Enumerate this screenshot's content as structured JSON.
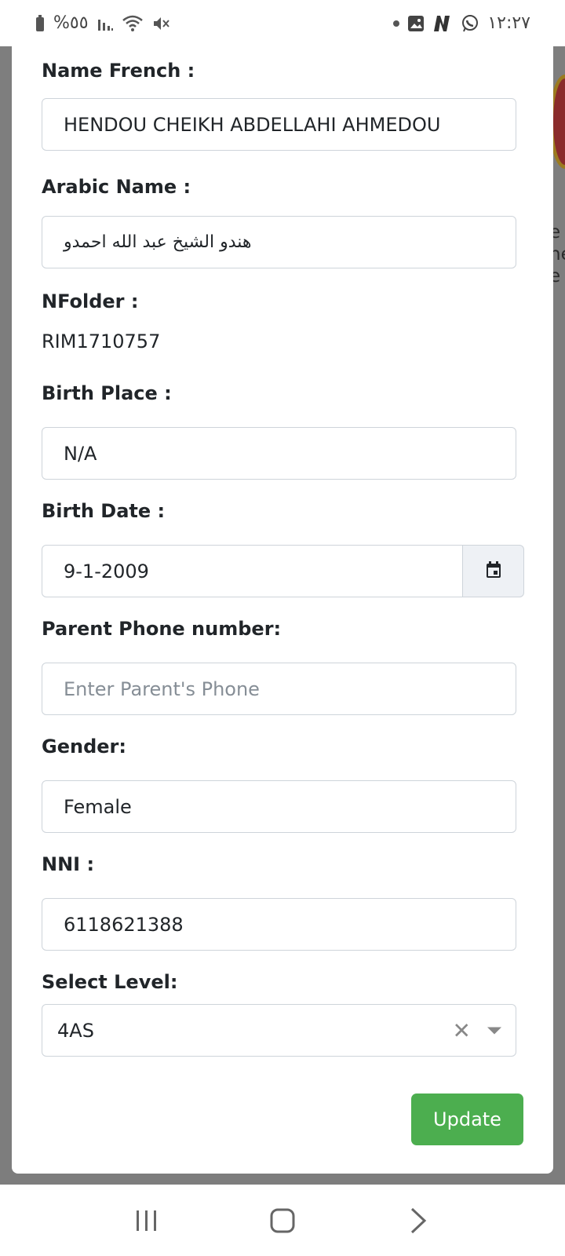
{
  "status_bar": {
    "battery_text": "%٥٥",
    "time": "١٢:٢٧"
  },
  "form": {
    "name_french": {
      "label": "Name French :",
      "value": "HENDOU CHEIKH ABDELLAHI AHMEDOU"
    },
    "arabic_name": {
      "label": "Arabic Name :",
      "value": "هندو الشيخ عبد الله احمدو"
    },
    "nfolder": {
      "label": "NFolder :",
      "value": "RIM1710757"
    },
    "birth_place": {
      "label": "Birth Place :",
      "value": "N/A"
    },
    "birth_date": {
      "label": "Birth Date :",
      "value": "9-1-2009"
    },
    "parent_phone": {
      "label": "Parent Phone number:",
      "placeholder": "Enter Parent's Phone"
    },
    "gender": {
      "label": "Gender:",
      "value": "Female"
    },
    "nni": {
      "label": "NNI :",
      "value": "6118621388"
    },
    "level": {
      "label": "Select Level:",
      "selected": "4AS"
    },
    "update_label": "Update"
  },
  "background": {
    "text_lines": [
      "e",
      "ne",
      "e l"
    ]
  },
  "colors": {
    "accent_green": "#4cae4f",
    "border": "#ced4da",
    "addon_bg": "#eef1f5"
  },
  "icons": [
    "battery-icon",
    "signal-icon",
    "wifi-icon",
    "mute-icon",
    "image-icon",
    "app-n-icon",
    "whatsapp-icon",
    "calendar-icon",
    "clear-icon",
    "chevron-down-icon",
    "recent-apps-icon",
    "home-icon",
    "back-icon"
  ]
}
